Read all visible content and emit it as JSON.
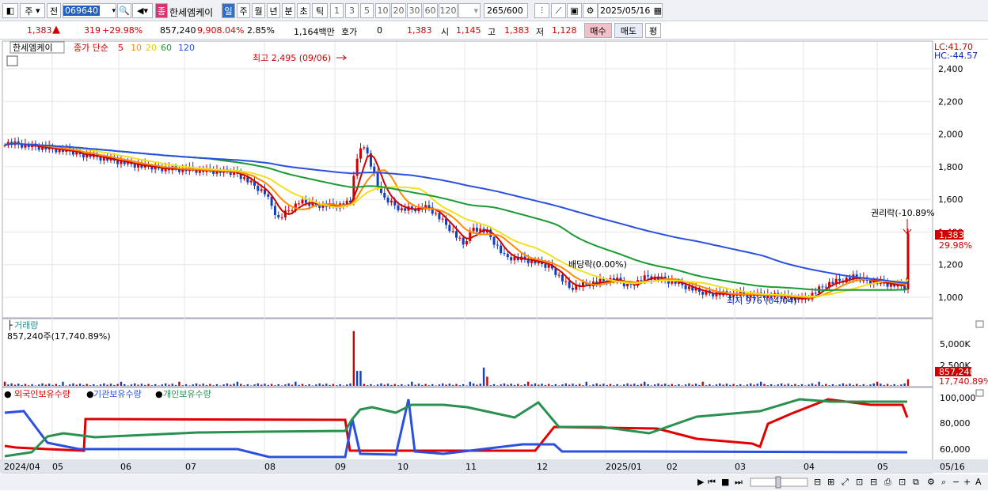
{
  "toolbar": {
    "market_type": "주",
    "prev_label": "전",
    "code": "069640",
    "name": "한세엠케이",
    "periods": [
      "일",
      "주",
      "월",
      "년",
      "분",
      "초",
      "틱"
    ],
    "intervals": [
      "1",
      "3",
      "5",
      "10",
      "20",
      "30",
      "60",
      "120"
    ],
    "count": "265",
    "count_max": "/600",
    "date": "2025/05/16"
  },
  "quote": {
    "price": "1,383",
    "change": "319",
    "change_pct": "+29.98%",
    "volume": "857,240",
    "volume_pct": "9,908.04%",
    "turnover_pct": "2.85%",
    "amount": "1,164백만",
    "hoga_label": "호가",
    "hoga_value": "0",
    "hoga_price": "1,383",
    "open_label": "시",
    "open": "1,145",
    "high_label": "고",
    "high": "1,383",
    "low_label": "저",
    "low": "1,128",
    "buy_label": "매수",
    "sell_label": "매도",
    "even_label": "평"
  },
  "price_panel": {
    "stock_label": "한세엠케이",
    "ma_label": "종가 단순",
    "ma_periods": [
      "5",
      "10",
      "20",
      "60",
      "120"
    ],
    "ma_colors": [
      "#d00000",
      "#ff8c00",
      "#f0e020",
      "#1a9a30",
      "#2a50e0"
    ],
    "lc": "LC:41.70",
    "hc": "HC:-44.57",
    "y_ticks": [
      "2,400",
      "2,200",
      "2,000",
      "1,800",
      "1,600",
      "1,400",
      "1,200",
      "1,000"
    ],
    "high_note": "최고 2,495 (09/06)",
    "low_note": "최저 976 (04/04)",
    "dividend_note": "배당락(0.00%)",
    "rights_note": "권리락(-10.89%",
    "last_price": "1,383",
    "last_pct": "29.98%"
  },
  "volume_panel": {
    "title": "거래량",
    "value": "857,240주(17,740.89%)",
    "y_ticks": [
      "5,000K",
      "2,500K"
    ],
    "last_value": "857,240",
    "last_pct": "17,740.89%"
  },
  "holding_panel": {
    "series": [
      {
        "name": "외국인보유수량",
        "color": "#e00000"
      },
      {
        "name": "기관보유수량",
        "color": "#2a50e0"
      },
      {
        "name": "개인보유수량",
        "color": "#2a9050"
      }
    ],
    "y_ticks": [
      "100,000",
      "80,000",
      "60,000"
    ]
  },
  "x_axis": {
    "labels": [
      "2024/04",
      "05",
      "06",
      "07",
      "08",
      "09",
      "10",
      "11",
      "12",
      "2025/01",
      "02",
      "03",
      "04",
      "05"
    ],
    "last_label": "05/16"
  }
}
